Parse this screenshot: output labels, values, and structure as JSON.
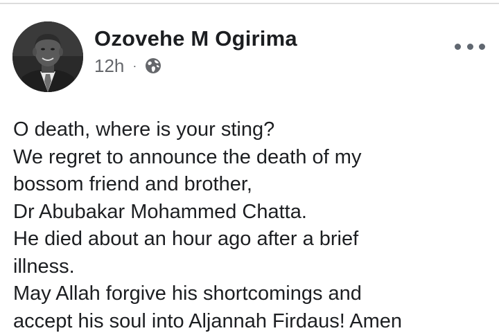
{
  "post": {
    "author": "Ozovehe M Ogirima",
    "timestamp": "12h",
    "separator": "·",
    "audience_icon": "globe-icon",
    "more_icon": "more-options-icon",
    "lines": [
      "O death, where is your sting?",
      "We regret to announce the death of my",
      "bossom friend and brother,",
      "Dr Abubakar Mohammed Chatta.",
      "He died about an hour ago after a brief",
      "illness.",
      "May Allah forgive his shortcomings and",
      "accept his soul into Aljannah Firdaus! Amen"
    ]
  },
  "colors": {
    "text_primary": "#1c1e21",
    "text_secondary": "#65676b",
    "divider": "#dcdcdc"
  }
}
